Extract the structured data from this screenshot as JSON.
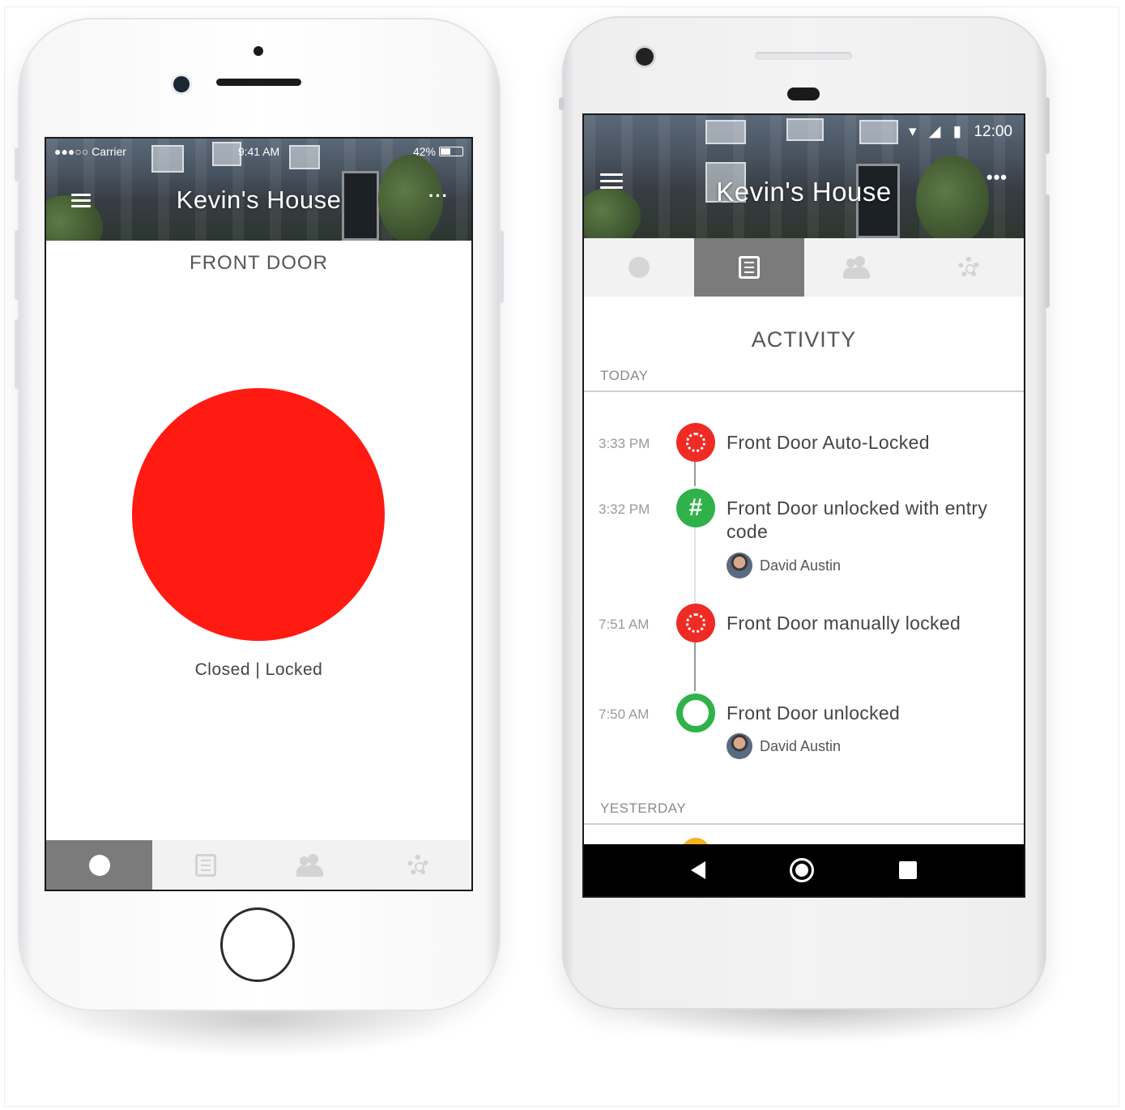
{
  "ios": {
    "status": {
      "carrier": "●●●○○ Carrier",
      "time": "9:41 AM",
      "battery": "42%"
    },
    "header": {
      "title": "Kevin's House",
      "more": "···"
    },
    "door_title": "FRONT DOOR",
    "lock_status": "Closed | Locked",
    "lock_color": "#ff1a12",
    "tabs": [
      {
        "icon": "dot-icon",
        "active": true
      },
      {
        "icon": "list-icon",
        "active": false
      },
      {
        "icon": "users-icon",
        "active": false
      },
      {
        "icon": "gear-icon",
        "active": false
      }
    ]
  },
  "android": {
    "status": {
      "time": "12:00"
    },
    "header": {
      "title": "Kevin's House",
      "more": "•••"
    },
    "tabs": [
      {
        "icon": "dot-icon",
        "active": false
      },
      {
        "icon": "list-icon",
        "active": true
      },
      {
        "icon": "users-icon",
        "active": false
      },
      {
        "icon": "gear-icon",
        "active": false
      }
    ],
    "activity": {
      "title": "ACTIVITY",
      "today_label": "TODAY",
      "yesterday_label": "YESTERDAY",
      "events": [
        {
          "time": "3:33 PM",
          "text": "Front Door Auto-Locked",
          "icon": "lock-icon",
          "color": "#ee2b24"
        },
        {
          "time": "3:32 PM",
          "text": "Front Door unlocked with entry code",
          "icon": "hash-icon",
          "color": "#2fb24a",
          "user": "David Austin"
        },
        {
          "time": "7:51 AM",
          "text": "Front Door manually locked",
          "icon": "lock-icon",
          "color": "#ee2b24"
        },
        {
          "time": "7:50 AM",
          "text": "Front Door unlocked",
          "icon": "unlock-ring-icon",
          "color": "#2fb24a",
          "user": "David Austin"
        }
      ]
    }
  }
}
